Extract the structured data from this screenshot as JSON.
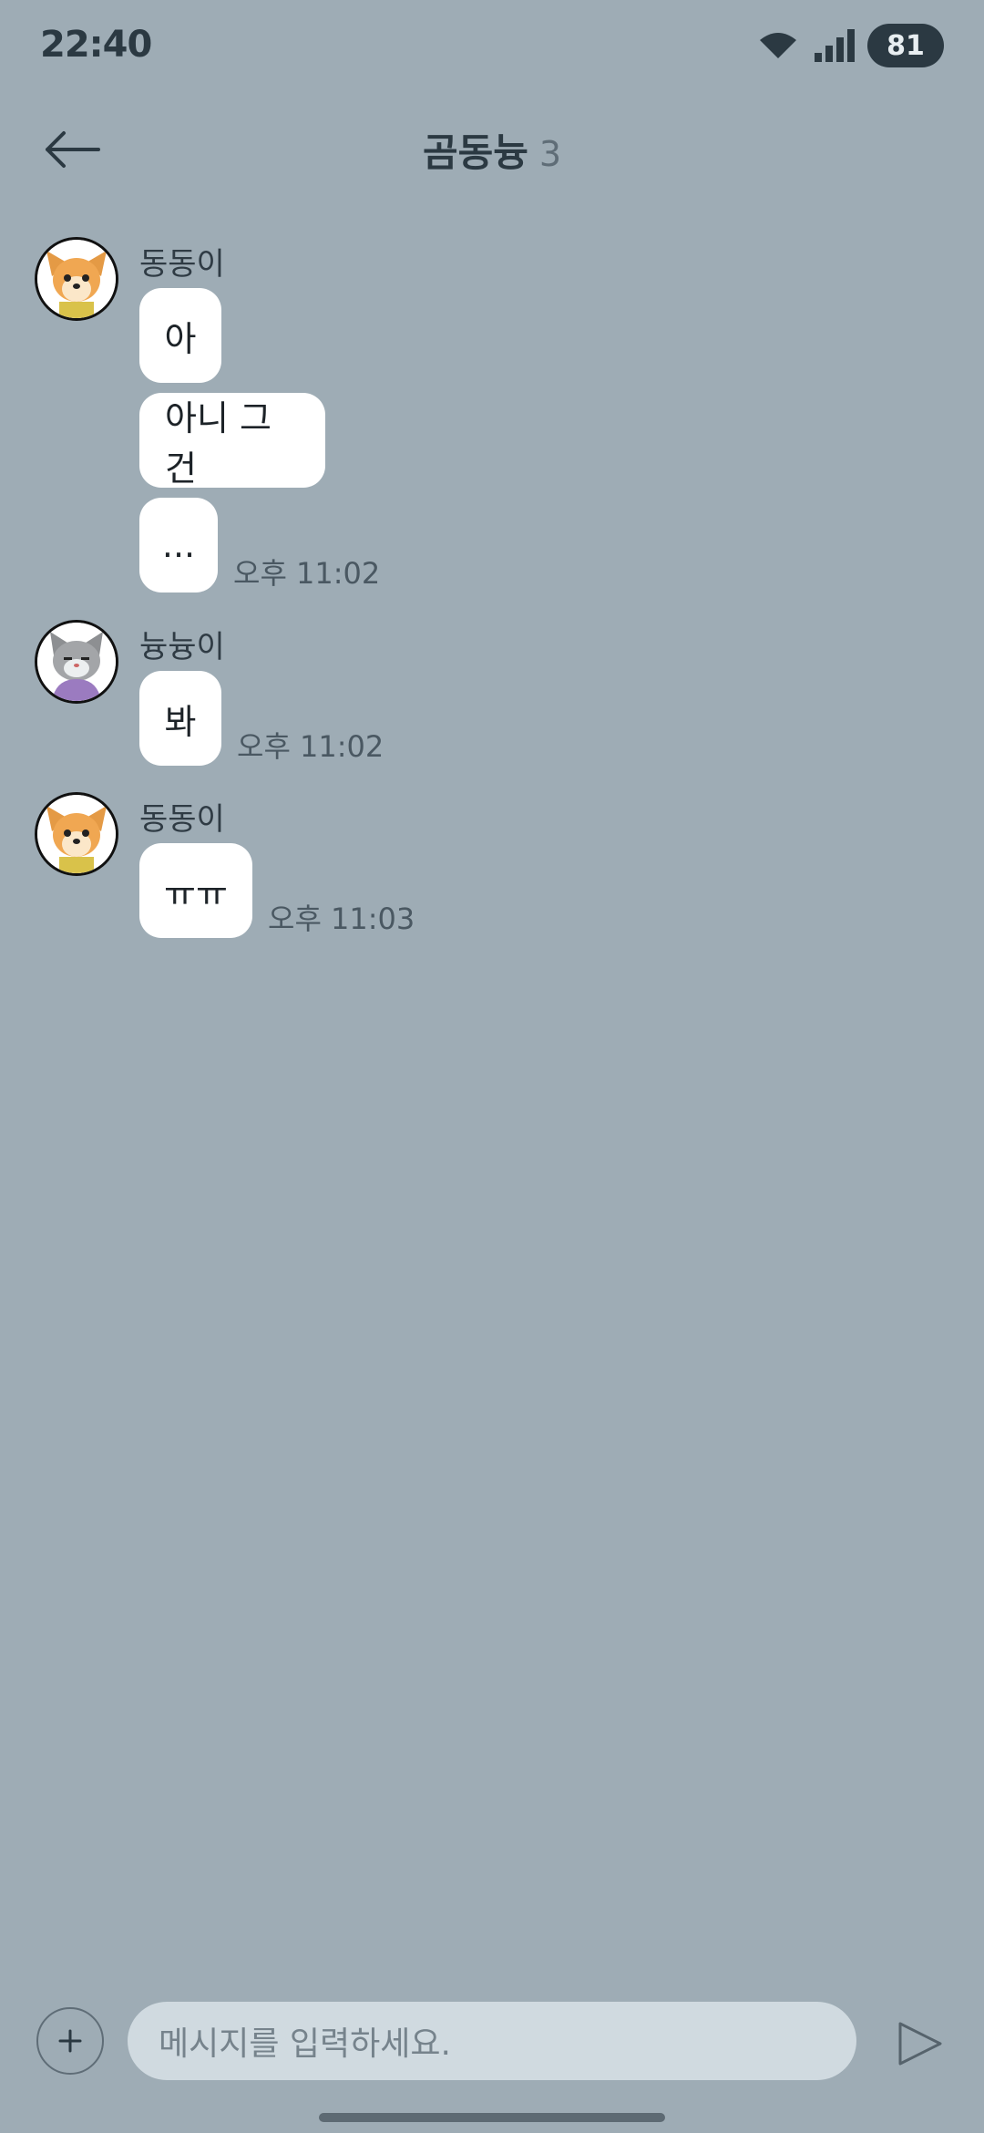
{
  "status_bar": {
    "time": "22:40",
    "battery": "81"
  },
  "header": {
    "title": "곰동늉",
    "member_count": "3"
  },
  "messages": [
    {
      "sender": "동동이",
      "avatar": "dog-avatar",
      "bubbles": [
        "아",
        "아니 그건",
        "..."
      ],
      "timestamp": "오후 11:02"
    },
    {
      "sender": "늉늉이",
      "avatar": "cat-avatar",
      "bubbles": [
        "봐"
      ],
      "timestamp": "오후 11:02"
    },
    {
      "sender": "동동이",
      "avatar": "dog-avatar",
      "bubbles": [
        "ㅠㅠ"
      ],
      "timestamp": "오후 11:03"
    }
  ],
  "composer": {
    "placeholder": "메시지를 입력하세요."
  },
  "icons": {
    "back": "arrow-left-icon",
    "plus": "plus-icon",
    "send": "send-icon",
    "wifi": "wifi-icon",
    "signal": "signal-icon"
  },
  "colors": {
    "background": "#9eacb5",
    "bubble": "#ffffff",
    "input": "#d0dae0",
    "battery": "#2b3942"
  }
}
